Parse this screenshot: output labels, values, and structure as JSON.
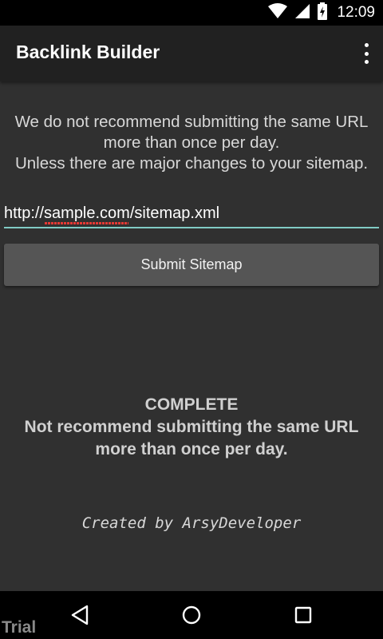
{
  "status_bar": {
    "time": "12:09",
    "icons": [
      "wifi-icon",
      "cell-signal-icon",
      "battery-charging-icon"
    ]
  },
  "app_bar": {
    "title": "Backlink Builder",
    "menu_icon": "overflow-menu-icon"
  },
  "notice": {
    "line1": "We do not recommend submitting the same URL",
    "line2": "more than once per day.",
    "line3": "Unless there are major changes to your sitemap."
  },
  "url_input": {
    "value": "http://sample.com/sitemap.xml"
  },
  "submit_button": {
    "label": "Submit Sitemap"
  },
  "result": {
    "status": "COMPLETE",
    "message_line1": "Not recommend submitting the same URL",
    "message_line2": "more than once per day."
  },
  "credit": "Created by ArsyDeveloper",
  "nav_bar": {
    "icons": [
      "back-icon",
      "home-icon",
      "recents-icon"
    ]
  },
  "watermark": "Trial",
  "colors": {
    "background": "#303030",
    "app_bar": "#212121",
    "accent_underline": "#80cbc4",
    "button": "#555555",
    "spell_error": "#e53935"
  }
}
